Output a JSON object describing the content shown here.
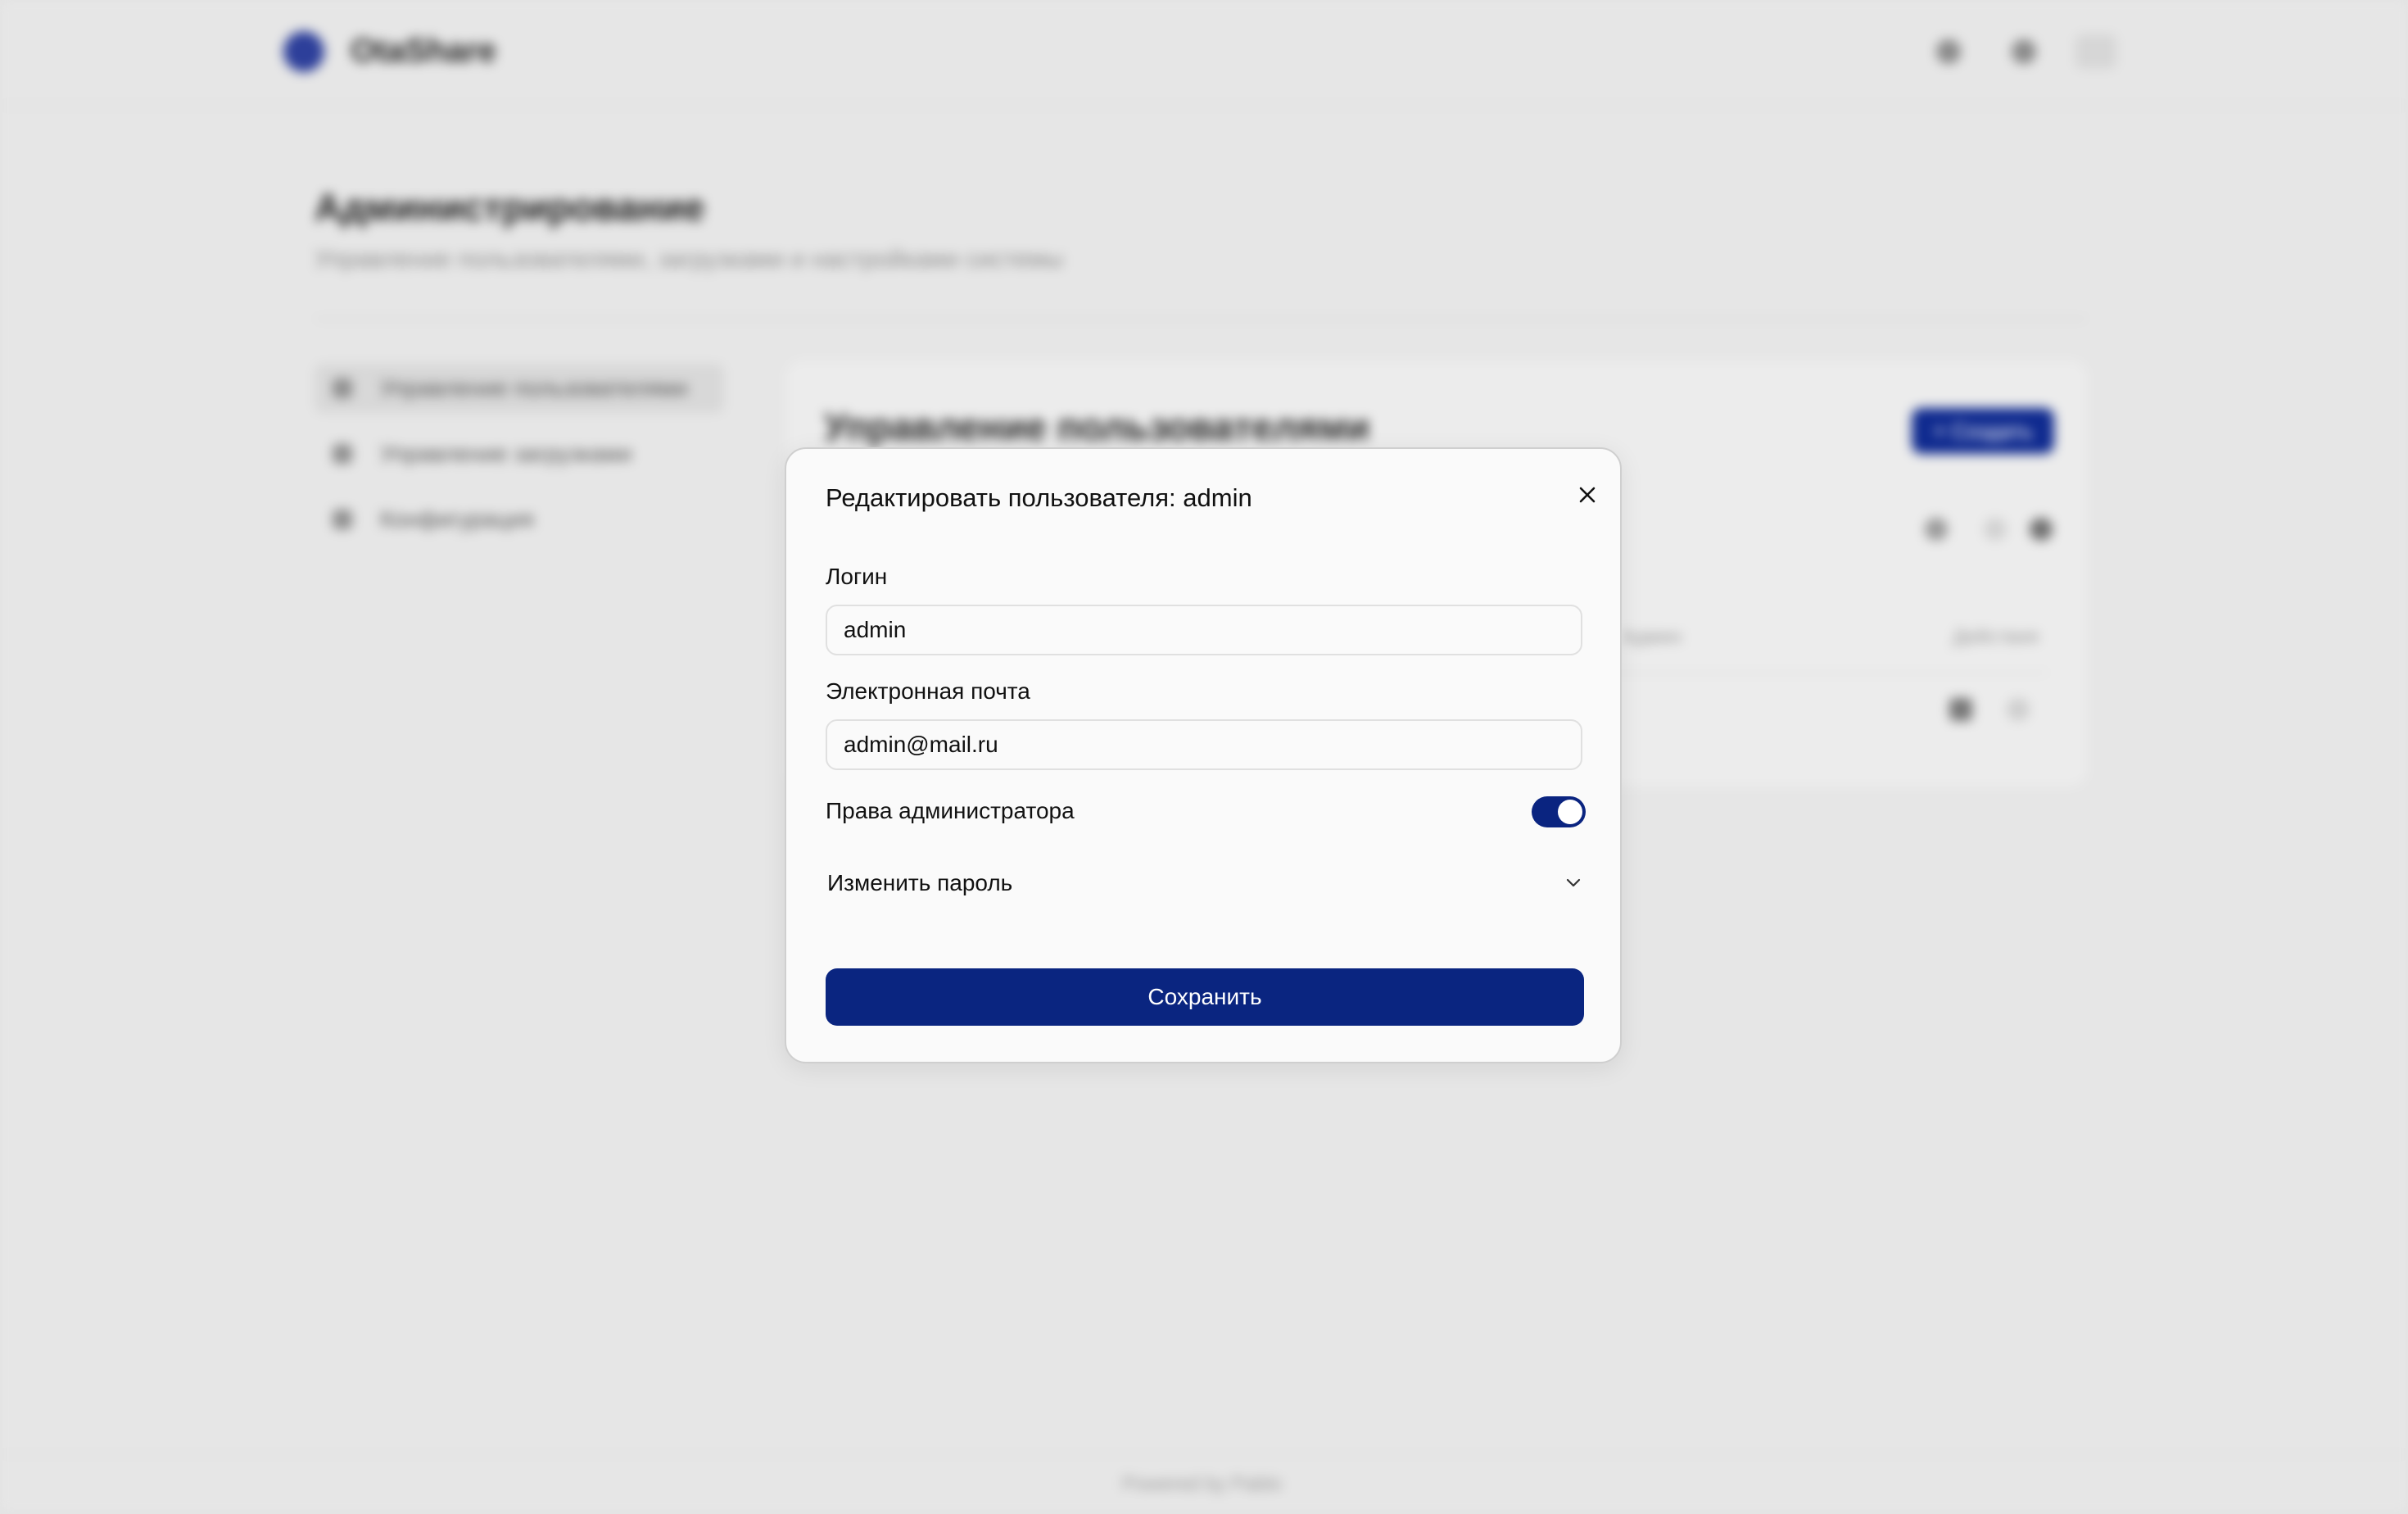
{
  "background": {
    "header": {
      "brand": "OtaShare"
    },
    "page": {
      "title": "Администрирование",
      "subtitle": "Управление пользователями, загрузками и настройками системы"
    },
    "nav": {
      "items": [
        {
          "label": "Управление пользователями"
        },
        {
          "label": "Управление загрузками"
        },
        {
          "label": "Конфигурация"
        }
      ]
    },
    "card": {
      "title": "Управление пользователями",
      "create_label": "+ Создать",
      "columns": [
        "Админ",
        "Действия"
      ]
    },
    "footer": {
      "text": "Powered by Pablo"
    }
  },
  "modal": {
    "title": "Редактировать пользователя: admin",
    "username": {
      "label": "Логин",
      "value": "admin"
    },
    "email": {
      "label": "Электронная почта",
      "value": "admin@mail.ru"
    },
    "admin_toggle": {
      "label": "Права администратора",
      "checked": true
    },
    "change_password": {
      "label": "Изменить пароль"
    },
    "save_label": "Сохранить"
  },
  "colors": {
    "primary": "#0a2580",
    "overlay": "#e3e3e3",
    "modal_bg": "#fafafa"
  },
  "icons": {
    "close": "close-icon",
    "chevron": "chevron-down-icon"
  }
}
